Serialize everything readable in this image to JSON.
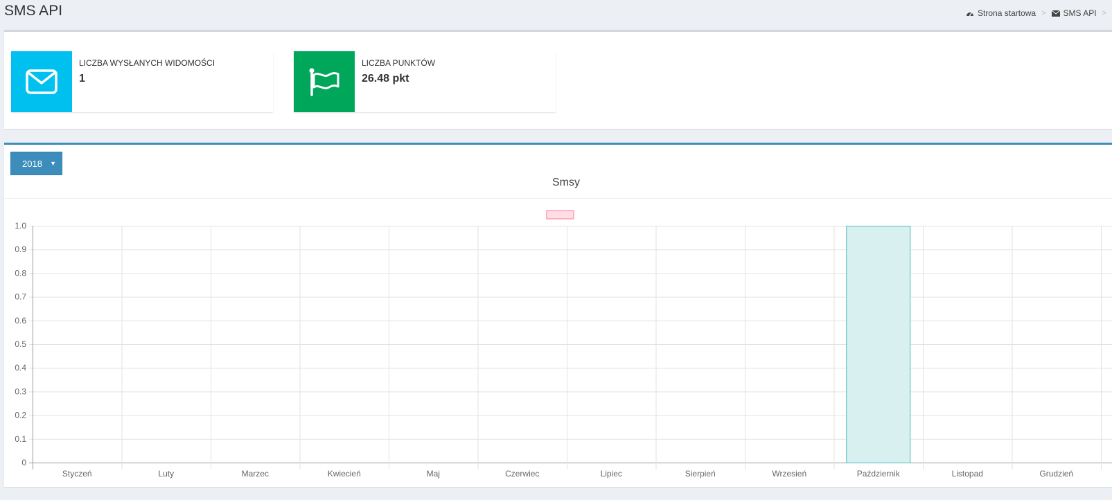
{
  "header": {
    "title": "SMS API",
    "breadcrumb": [
      {
        "label": "Strona startowa",
        "icon": "dashboard-icon"
      },
      {
        "label": "SMS API",
        "icon": "envelope-icon"
      }
    ]
  },
  "stats": [
    {
      "label": "LICZBA WYSŁANYCH WIDOMOŚCI",
      "value": "1",
      "icon": "envelope-icon",
      "color": "#00c0ef"
    },
    {
      "label": "LICZBA PUNKTÓW",
      "value": "26.48 pkt",
      "icon": "flag-icon",
      "color": "#00a65a"
    }
  ],
  "year_select": {
    "value": "2018"
  },
  "chart_data": {
    "type": "bar",
    "title": "Smsy",
    "categories": [
      "Styczeń",
      "Luty",
      "Marzec",
      "Kwiecień",
      "Maj",
      "Czerwiec",
      "Lipiec",
      "Sierpień",
      "Wrzesień",
      "Październik",
      "Listopad",
      "Grudzień"
    ],
    "series": [
      {
        "values": [
          0,
          0,
          0,
          0,
          0,
          0,
          0,
          0,
          0,
          1,
          0,
          0
        ],
        "fill": "#d9f0f1",
        "stroke": "#4bc0c0"
      }
    ],
    "legend_swatch": {
      "fill": "#ffdde4",
      "stroke": "#ff9fb3"
    },
    "ylim": [
      0,
      1
    ],
    "yticks": [
      "0",
      "0.1",
      "0.2",
      "0.3",
      "0.4",
      "0.5",
      "0.6",
      "0.7",
      "0.8",
      "0.9",
      "1.0"
    ],
    "grid": true
  }
}
